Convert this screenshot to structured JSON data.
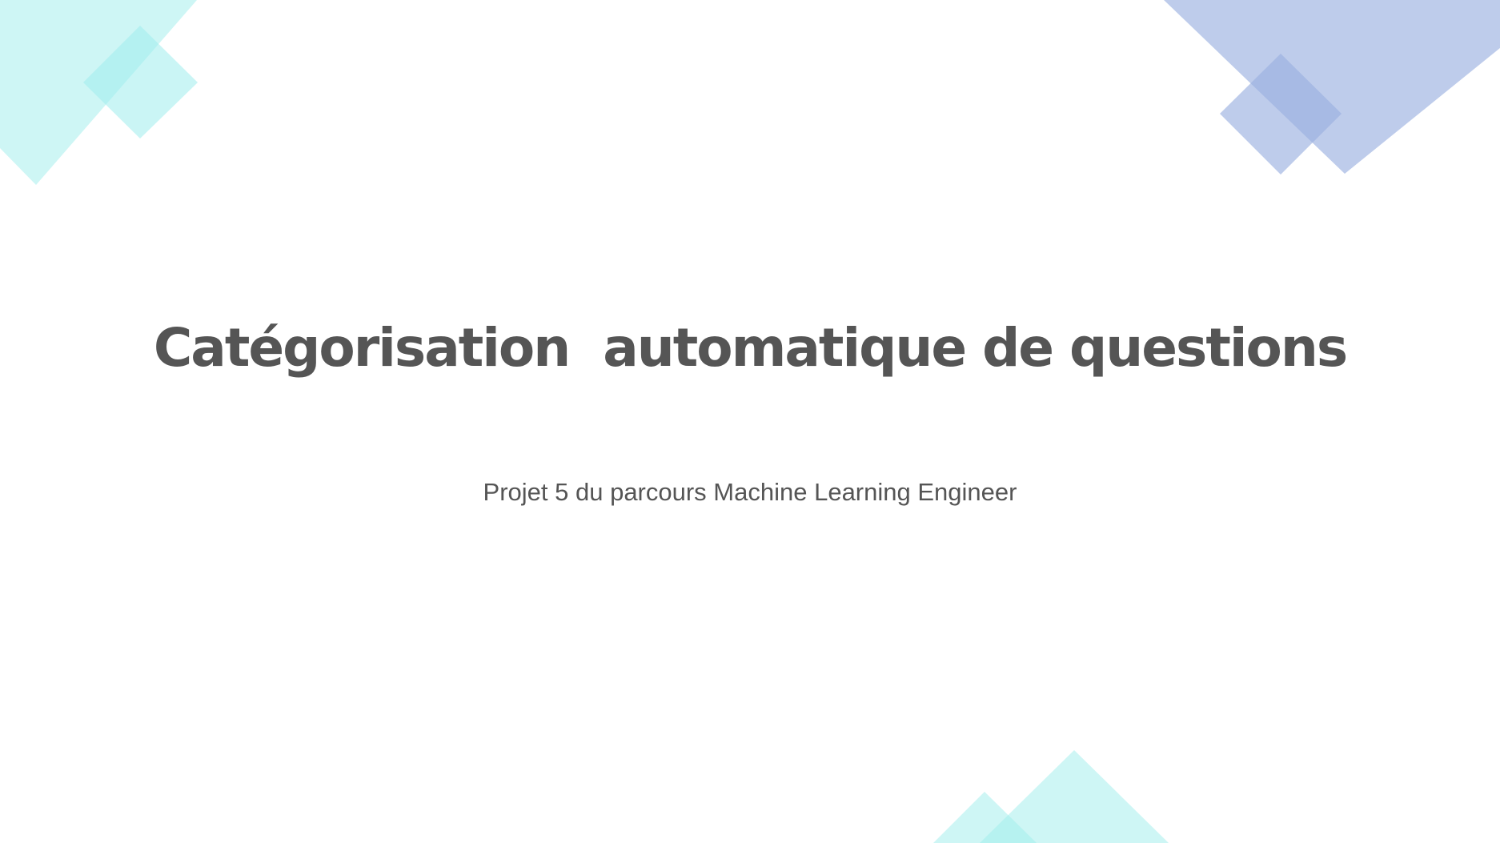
{
  "slide": {
    "title": "Catégorisation  automatique de questions",
    "subtitle": "Projet 5 du parcours Machine Learning Engineer"
  },
  "colors": {
    "background": "#ffffff",
    "text": "#555555",
    "accent_cyan": "#9EEDEC",
    "accent_blue": "#9BB0E0"
  }
}
